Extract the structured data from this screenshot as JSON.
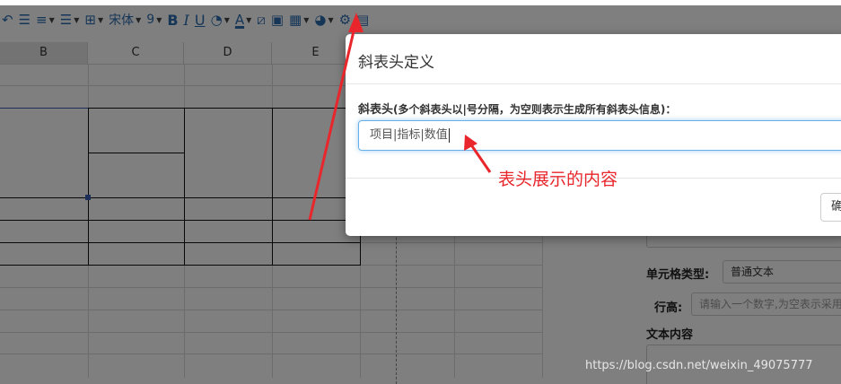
{
  "toolbar": {
    "font_name": "宋体",
    "font_size": "9",
    "bold": "B",
    "italic": "I",
    "underline": "U",
    "font_color": "A"
  },
  "sheet": {
    "columns": [
      "B",
      "C",
      "D",
      "E"
    ]
  },
  "panel": {
    "cell_type_label": "单元格类型:",
    "cell_type_value": "普通文本",
    "row_height_label": "行高:",
    "row_height_placeholder": "请输入一个数字,为空表示采用默认",
    "text_content_label": "文本内容"
  },
  "modal": {
    "title": "斜表头定义",
    "field_label": "斜表头",
    "field_hint": "(多个斜表头以|号分隔，为空则表示生成所有斜表头信息)：",
    "input_value": "项目|指标|数值",
    "ok_button": "确"
  },
  "annotation": {
    "text": "表头展示的内容",
    "color": "#e8262b"
  },
  "watermark": "https://blog.csdn.net/weixin_49075777",
  "colors": {
    "toolbar_icon": "#2c6db0",
    "input_focus": "#66afe9",
    "overlay": "rgba(0,0,0,0.5)"
  }
}
